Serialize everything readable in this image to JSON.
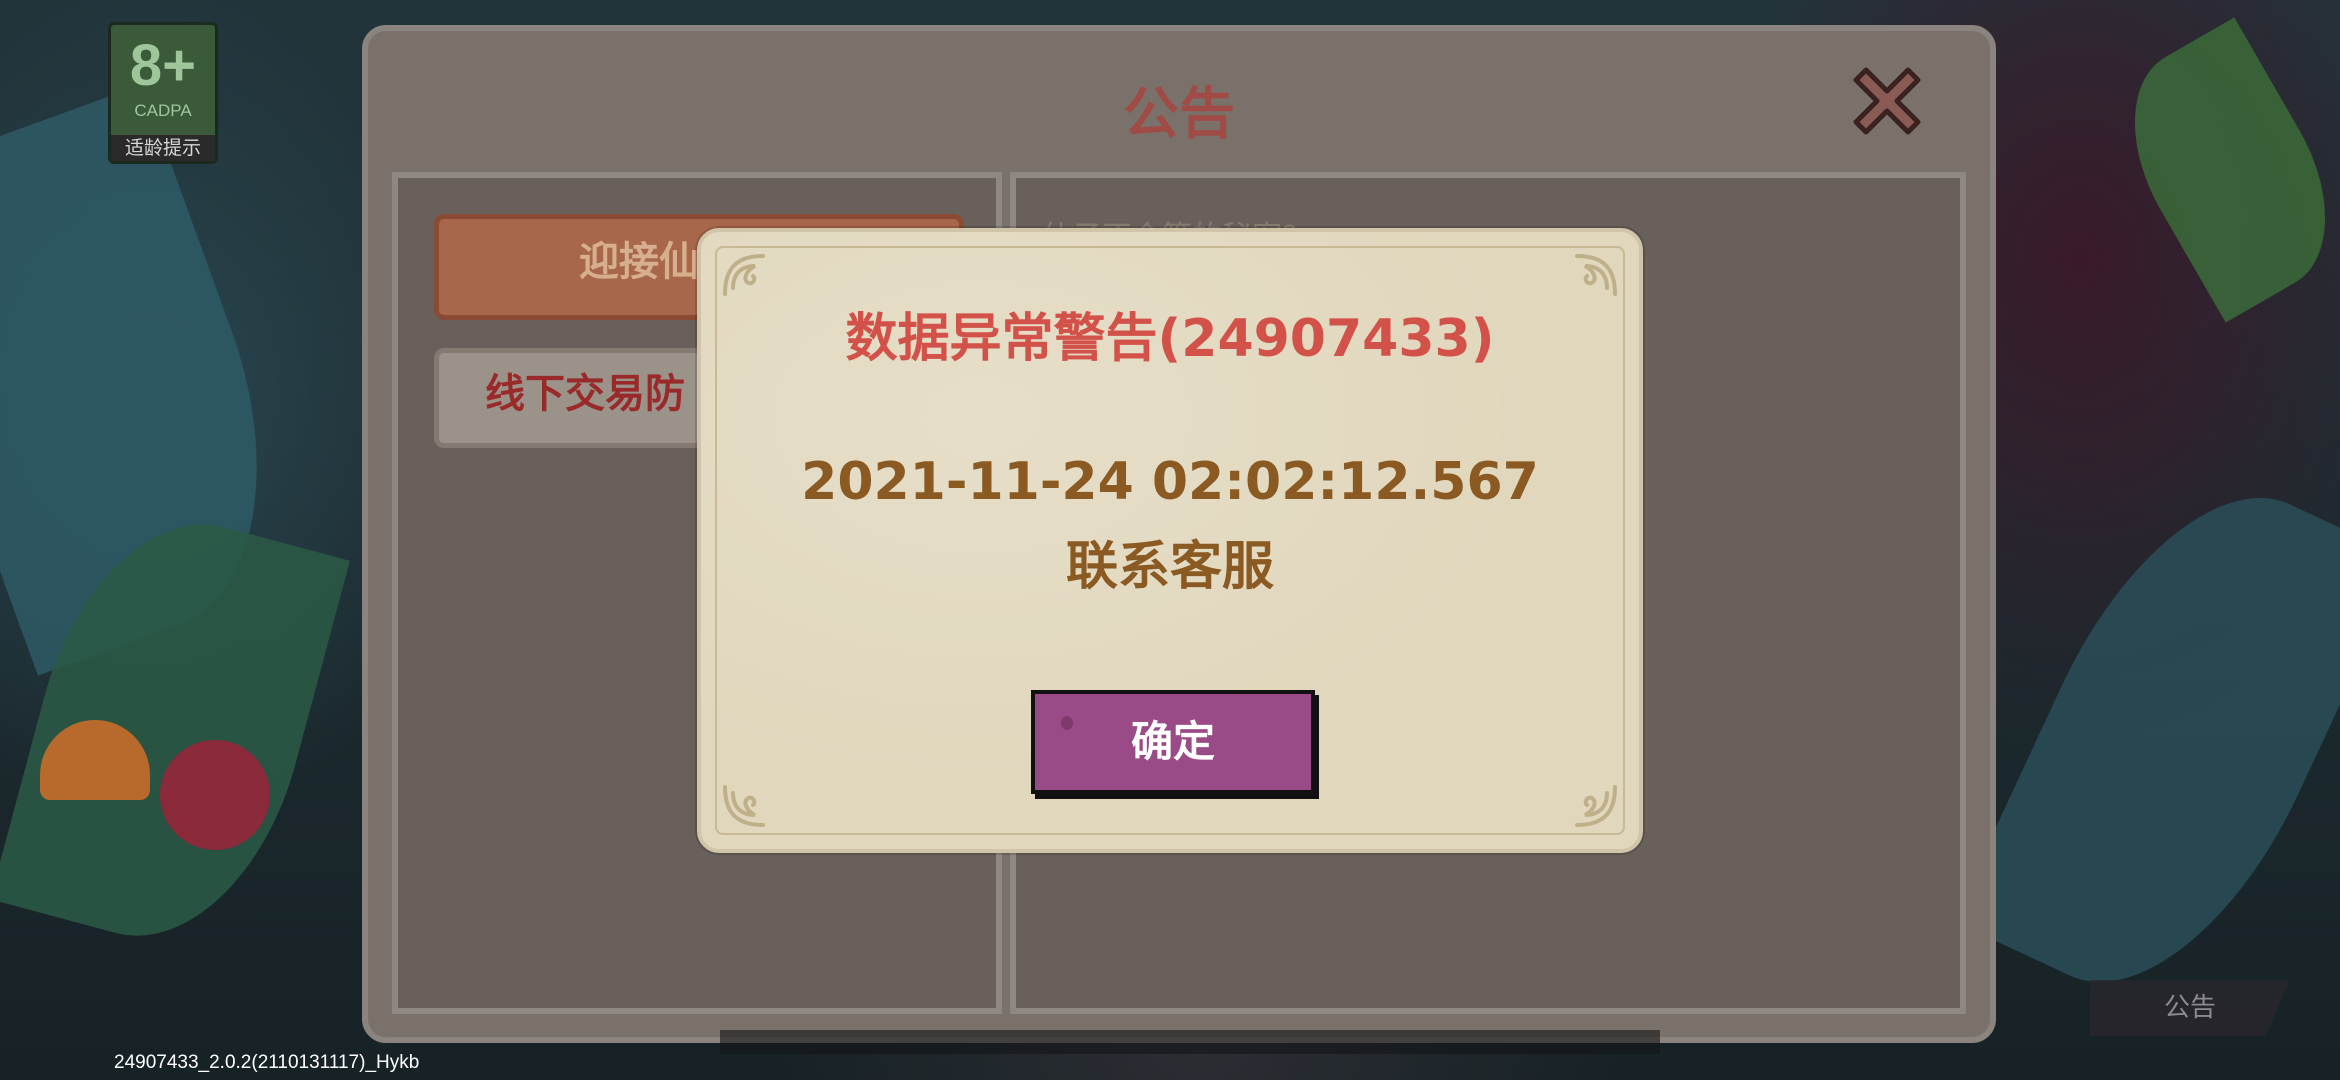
{
  "rating_badge": {
    "age": "8+",
    "org": "CADPA",
    "tip": "适龄提示"
  },
  "version_text": "24907433_2.0.2(2110131117)_Hykb",
  "corner_button_label": "公告",
  "notice_panel": {
    "title": "公告",
    "tabs": [
      {
        "label": "迎接仙",
        "state": "selected"
      },
      {
        "label": "线下交易防",
        "state": "normal"
      }
    ],
    "content_partial": "仙子不会算的秘密?"
  },
  "alert_dialog": {
    "title": "数据异常警告(24907433)",
    "timestamp": "2021-11-24 02:02:12.567",
    "message": "联系客服",
    "confirm_label": "确定"
  },
  "colors": {
    "dialog_title": "#d2524a",
    "dialog_text": "#8a5a22",
    "confirm_button": "#9a4a86",
    "panel_title": "#a04b45"
  },
  "icons": [
    "close-icon",
    "corner-ornament-icon"
  ]
}
